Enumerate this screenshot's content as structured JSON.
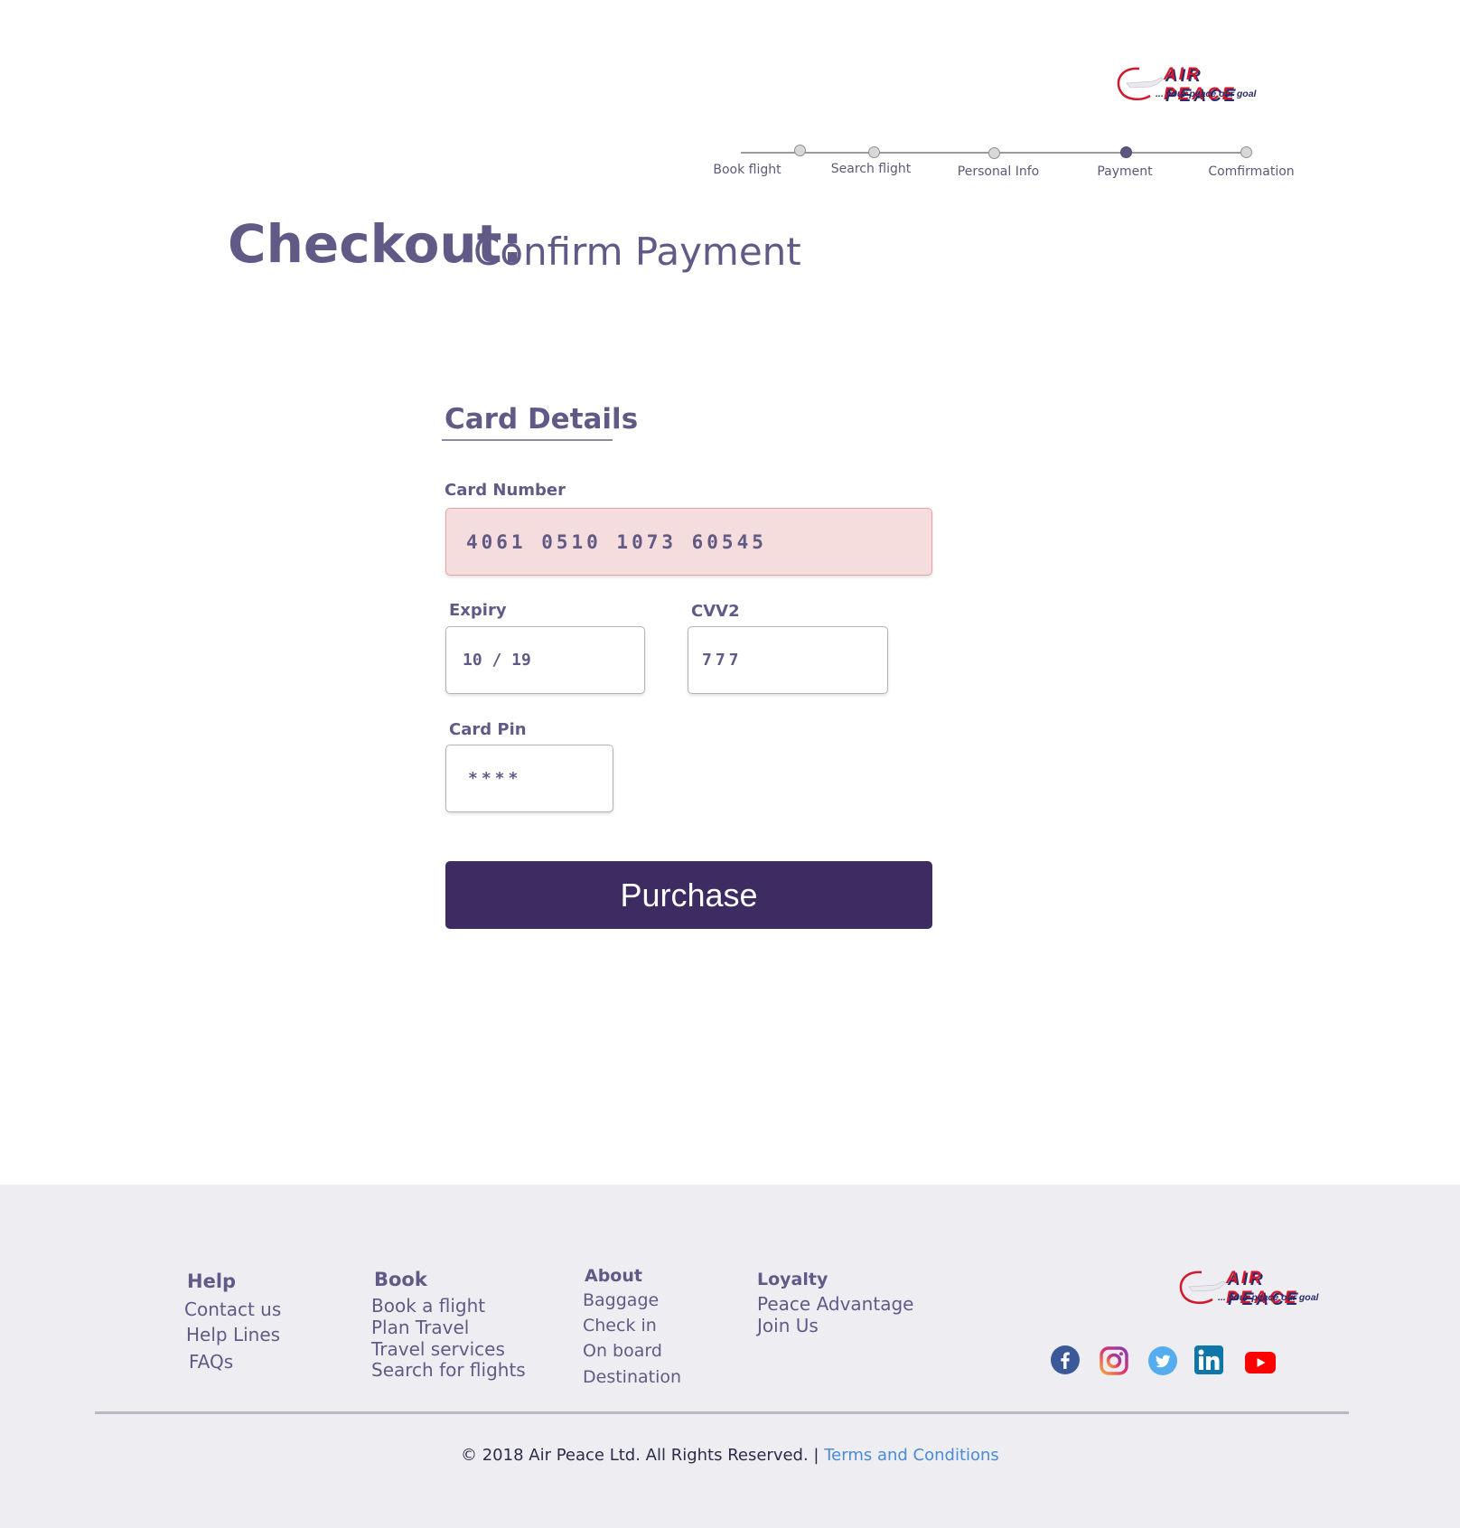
{
  "header": {
    "logo": {
      "brand": "AIR PEACE",
      "tagline": "... your peace our goal"
    },
    "stepper": {
      "steps": [
        {
          "label": "Book flight"
        },
        {
          "label": "Search flight"
        },
        {
          "label": "Personal Info"
        },
        {
          "label": "Payment"
        },
        {
          "label": "Comfirmation"
        }
      ],
      "active_step": "Payment"
    }
  },
  "page": {
    "title": "Checkout:",
    "subtitle": "Confirm Payment"
  },
  "card_details": {
    "heading": "Card Details",
    "card_number": {
      "label": "Card Number",
      "value": "4061 0510 1073 60545"
    },
    "expiry": {
      "label": "Expiry",
      "value": "10 / 19"
    },
    "cvv2": {
      "label": "CVV2",
      "value": "777"
    },
    "pin": {
      "label": "Card Pin",
      "value": "****"
    },
    "purchase_label": "Purchase"
  },
  "footer": {
    "columns": [
      {
        "heading": "Help",
        "items": [
          "Contact us",
          "Help Lines",
          "FAQs"
        ]
      },
      {
        "heading": "Book",
        "items": [
          "Book a flight",
          "Plan Travel",
          "Travel services",
          "Search for flights"
        ]
      },
      {
        "heading": "About",
        "items": [
          "Baggage",
          "Check in",
          "On board",
          "Destination"
        ]
      },
      {
        "heading": "Loyalty",
        "items": [
          "Peace Advantage",
          "Join Us"
        ]
      }
    ],
    "logo": {
      "brand": "AIR PEACE",
      "tagline": "... your peace our goal"
    },
    "social": [
      "facebook-icon",
      "instagram-icon",
      "twitter-icon",
      "linkedin-icon",
      "youtube-icon"
    ],
    "copyright": "© 2018 Air Peace Ltd. All Rights Reserved. |",
    "terms": "Terms and Conditions"
  },
  "colors": {
    "primary": "#625a86",
    "button": "#3d2c61",
    "error_field": "#f5dcdd",
    "footer_bg": "#eeedf2",
    "link": "#4a8bd4"
  }
}
